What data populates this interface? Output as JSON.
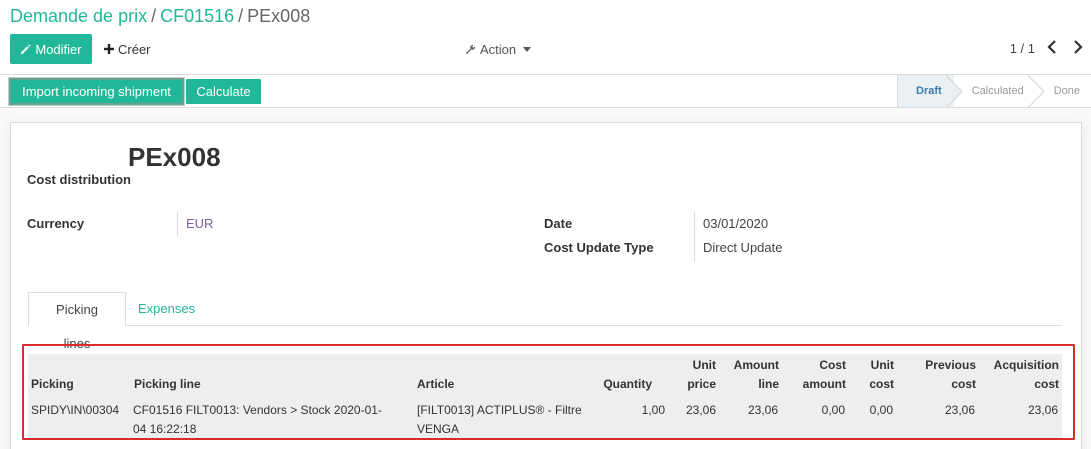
{
  "breadcrumb": {
    "item1": "Demande de prix",
    "item2": "CF01516",
    "current": "PEx008",
    "separator": "/"
  },
  "toolbar": {
    "edit_label": "Modifier",
    "create_label": "Créer",
    "action_label": "Action",
    "pager": "1 / 1"
  },
  "statusbar": {
    "import_label": "Import incoming shipment",
    "calculate_label": "Calculate",
    "stages": [
      "Draft",
      "Calculated",
      "Done"
    ],
    "active_stage": "Draft"
  },
  "form": {
    "subtitle": "Cost distribution",
    "title": "PEx008",
    "currency_label": "Currency",
    "currency_value": "EUR",
    "date_label": "Date",
    "date_value": "03/01/2020",
    "update_type_label": "Cost Update Type",
    "update_type_value": "Direct Update"
  },
  "tabs": [
    "Picking lines",
    "Expenses"
  ],
  "table": {
    "headers": {
      "picking": "Picking",
      "picking_line": "Picking line",
      "article": "Article",
      "quantity": "Quantity",
      "unit_price_1": "Unit",
      "unit_price_2": "price",
      "amount_line_1": "Amount",
      "amount_line_2": "line",
      "cost_amount_1": "Cost",
      "cost_amount_2": "amount",
      "unit_cost_1": "Unit",
      "unit_cost_2": "cost",
      "previous_cost_1": "Previous",
      "previous_cost_2": "cost",
      "acquisition_cost_1": "Acquisition",
      "acquisition_cost_2": "cost"
    },
    "row": {
      "picking": "SPIDY\\IN\\00304",
      "picking_line_1": "CF01516 FILT0013: Vendors > Stock 2020-01-",
      "picking_line_2": "04 16:22:18",
      "article_1": "[FILT0013] ACTIPLUS® - Filtre",
      "article_2": "VENGA",
      "quantity": "1,00",
      "unit_price": "23,06",
      "amount_line": "23,06",
      "cost_amount": "0,00",
      "unit_cost": "0,00",
      "previous_cost": "23,06",
      "acquisition_cost": "23,06"
    }
  },
  "colors": {
    "brand": "#21b799",
    "link": "#7c5fa3",
    "active_stage": "#3d7ea8",
    "highlight": "#d62c2c"
  }
}
